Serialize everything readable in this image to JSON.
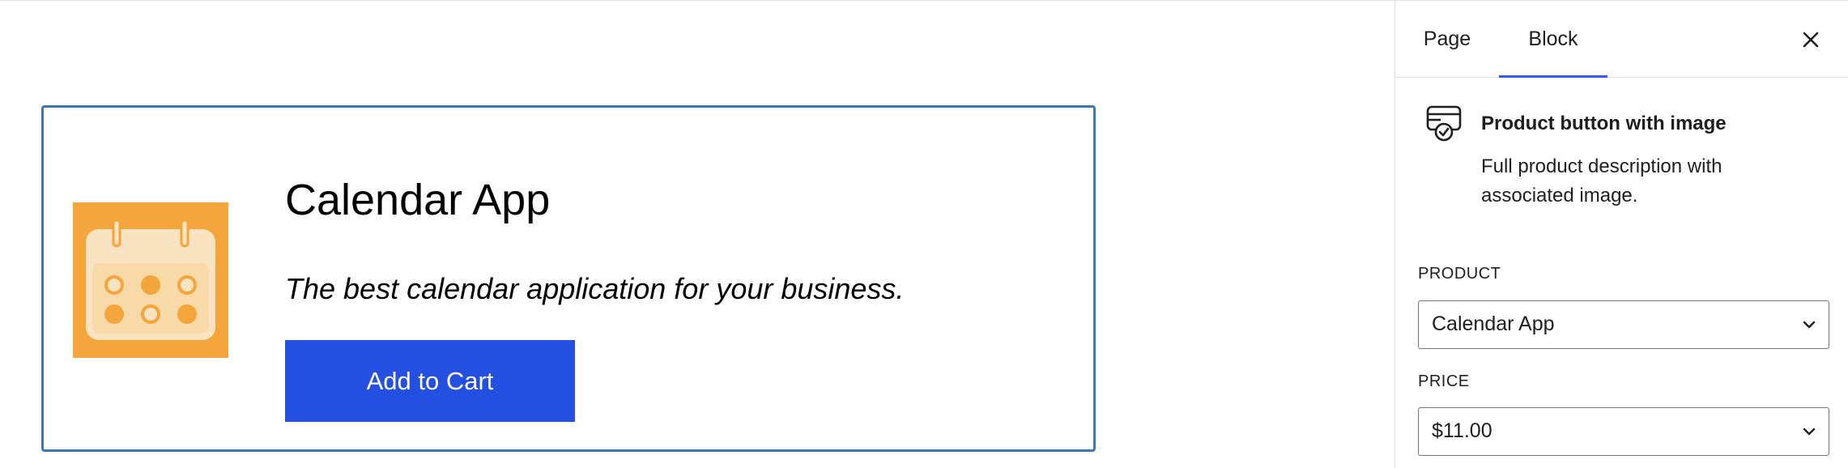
{
  "product_block": {
    "title": "Calendar App",
    "description": "The best calendar application for your business.",
    "button_label": "Add to Cart",
    "image_icon": "calendar-icon"
  },
  "sidebar": {
    "tabs": [
      {
        "label": "Page",
        "active": false
      },
      {
        "label": "Block",
        "active": true
      }
    ],
    "close_icon": "close-icon",
    "block_card": {
      "icon": "product-button-icon",
      "title": "Product button with image",
      "description": "Full product description with associated image."
    },
    "fields": {
      "product": {
        "label": "PRODUCT",
        "value": "Calendar App"
      },
      "price": {
        "label": "PRICE",
        "value": "$11.00"
      }
    }
  },
  "colors": {
    "accent": "#3858e9",
    "button_bg": "#2450e2",
    "block_outline": "#3a78b9",
    "image_orange": "#f4a53c",
    "image_cream": "#fae3c0"
  }
}
